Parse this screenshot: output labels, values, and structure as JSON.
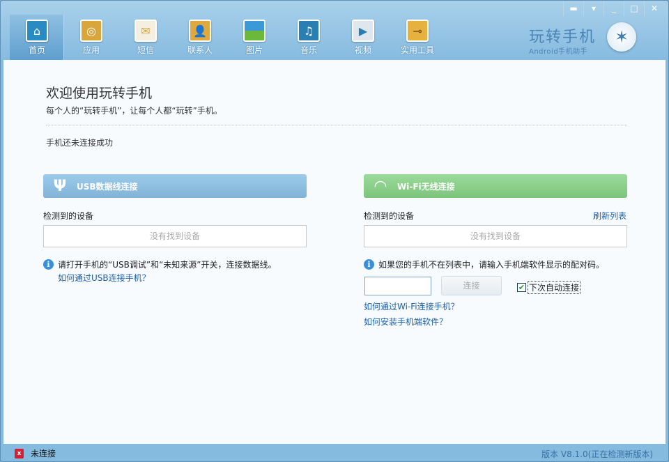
{
  "app": {
    "brand_title": "玩转手机",
    "brand_subtitle": "Android手机助手"
  },
  "nav": [
    {
      "label": "首页",
      "icon": "home-icon",
      "active": true
    },
    {
      "label": "应用",
      "icon": "app-disc-icon"
    },
    {
      "label": "短信",
      "icon": "envelope-icon"
    },
    {
      "label": "联系人",
      "icon": "contacts-icon"
    },
    {
      "label": "图片",
      "icon": "picture-icon"
    },
    {
      "label": "音乐",
      "icon": "music-note-icon"
    },
    {
      "label": "视频",
      "icon": "video-icon"
    },
    {
      "label": "实用工具",
      "icon": "toolbox-icon"
    }
  ],
  "main": {
    "title": "欢迎使用玩转手机",
    "subtitle": "每个人的“玩转手机”，让每个人都“玩转”手机。",
    "status": "手机还未连接成功",
    "usb": {
      "header": "USB数据线连接",
      "devices_label": "检测到的设备",
      "no_device": "没有找到设备",
      "info": "请打开手机的“USB调试”和“未知来源”开关，连接数据线。",
      "help_link": "如何通过USB连接手机？"
    },
    "wifi": {
      "header": "Wi-Fi无线连接",
      "devices_label": "检测到的设备",
      "refresh": "刷新列表",
      "no_device": "没有找到设备",
      "info": "如果您的手机不在列表中，请输入手机端软件显示的配对码。",
      "code_value": "",
      "connect": "连接",
      "auto_connect": "下次自动连接",
      "auto_connect_checked": true,
      "help_link": "如何通过Wi-Fi连接手机？",
      "install_link": "如何安装手机端软件？"
    }
  },
  "statusbar": {
    "connection": "未连接",
    "version": "版本 V8.1.0(正在检测新版本)"
  }
}
